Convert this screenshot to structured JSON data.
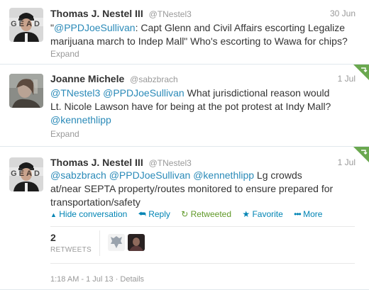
{
  "tweets": [
    {
      "name": "Thomas J. Nestel III",
      "handle": "@TNestel3",
      "time": "30 Jun",
      "text_parts": [
        {
          "t": "\"",
          "link": false
        },
        {
          "t": "@PPDJoeSullivan",
          "link": true
        },
        {
          "t": ": Capt Glenn and Civil Affairs escorting Legalize marijuana march to Indep Mall\" Who's escorting to Wawa for chips?",
          "link": false
        }
      ],
      "expand": "Expand"
    },
    {
      "name": "Joanne Michele",
      "handle": "@sabzbrach",
      "time": "1 Jul",
      "text_parts": [
        {
          "t": "@TNestel3",
          "link": true
        },
        {
          "t": " ",
          "link": false
        },
        {
          "t": "@PPDJoeSullivan",
          "link": true
        },
        {
          "t": " What jurisdictional reason would Lt. Nicole Lawson have for being at the pot protest at Indy Mall? ",
          "link": false
        },
        {
          "t": "@kennethlipp",
          "link": true
        }
      ],
      "expand": "Expand"
    },
    {
      "name": "Thomas J. Nestel III",
      "handle": "@TNestel3",
      "time": "1 Jul",
      "text_parts": [
        {
          "t": "@sabzbrach",
          "link": true
        },
        {
          "t": " ",
          "link": false
        },
        {
          "t": "@PPDJoeSullivan",
          "link": true
        },
        {
          "t": " ",
          "link": false
        },
        {
          "t": "@kennethlipp",
          "link": true
        },
        {
          "t": " Lg crowds at/near SEPTA property/routes monitored to ensure prepared for transportation/safety",
          "link": false
        }
      ]
    }
  ],
  "avatar_text": "GEAD",
  "actions": {
    "hide": "Hide conversation",
    "reply": "Reply",
    "retweeted": "Retweeted",
    "favorite": "Favorite",
    "more": "More"
  },
  "stats": {
    "retweet_count": "2",
    "retweet_label": "RETWEETS"
  },
  "footer": "1:18 AM - 1 Jul 13 · Details",
  "colors": {
    "link": "#2a8ab8",
    "retweeted": "#609928",
    "corner": "#6aa84f"
  }
}
